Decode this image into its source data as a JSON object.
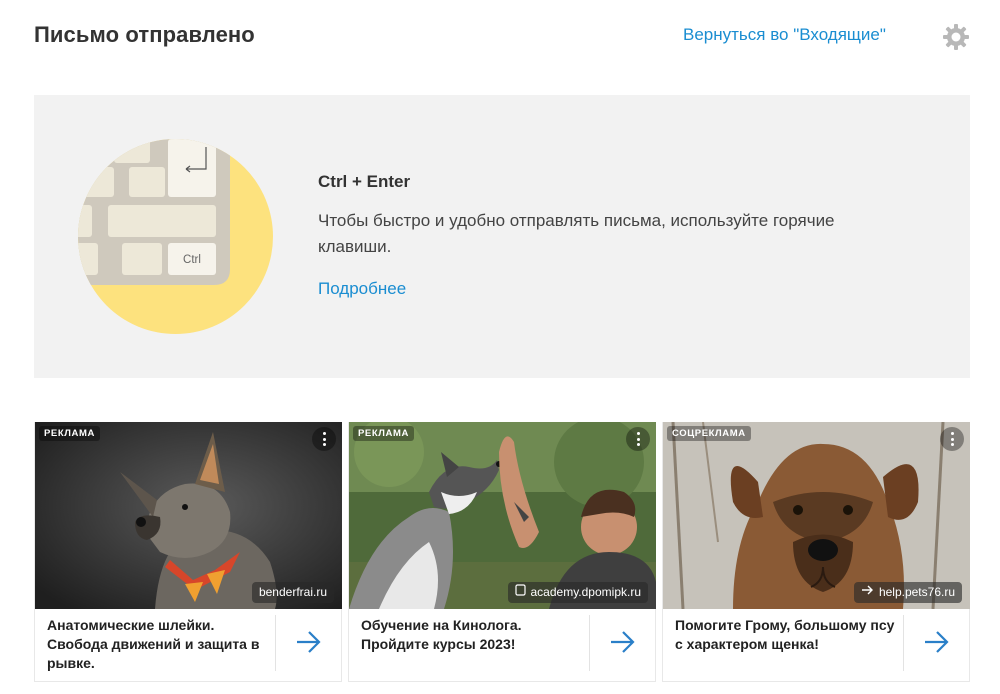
{
  "header": {
    "title": "Письмо отправлено",
    "back_link": "Вернуться во \"Входящие\"",
    "settings_icon": "gear-icon"
  },
  "promo": {
    "illustration_key_label": "Ctrl",
    "title": "Ctrl + Enter",
    "text": "Чтобы быстро и удобно отправлять письма, используйте горячие клавиши.",
    "link": "Подробнее"
  },
  "ads": [
    {
      "badge": "РЕКЛАМА",
      "domain": "benderfrai.ru",
      "text": "Анатомические шлейки. Свобода движений и защита в рывке.",
      "arrow_icon": "arrow-right-icon"
    },
    {
      "badge": "РЕКЛАМА",
      "domain": "academy.dpomipk.ru",
      "domain_icon": "page-icon",
      "text": "Обучение на Кинолога. Пройдите курсы 2023!",
      "arrow_icon": "arrow-right-icon"
    },
    {
      "badge": "СОЦРЕКЛАМА",
      "domain": "help.pets76.ru",
      "domain_icon": "arrow-right-icon",
      "text": "Помогите Грому, большому псу с характером щенка!",
      "arrow_icon": "arrow-right-icon"
    }
  ],
  "colors": {
    "link": "#1a8dd1",
    "promo_bg": "#f2f2f2",
    "illustration_circle": "#fde27e",
    "ad_arrow": "#2a7fc8"
  }
}
